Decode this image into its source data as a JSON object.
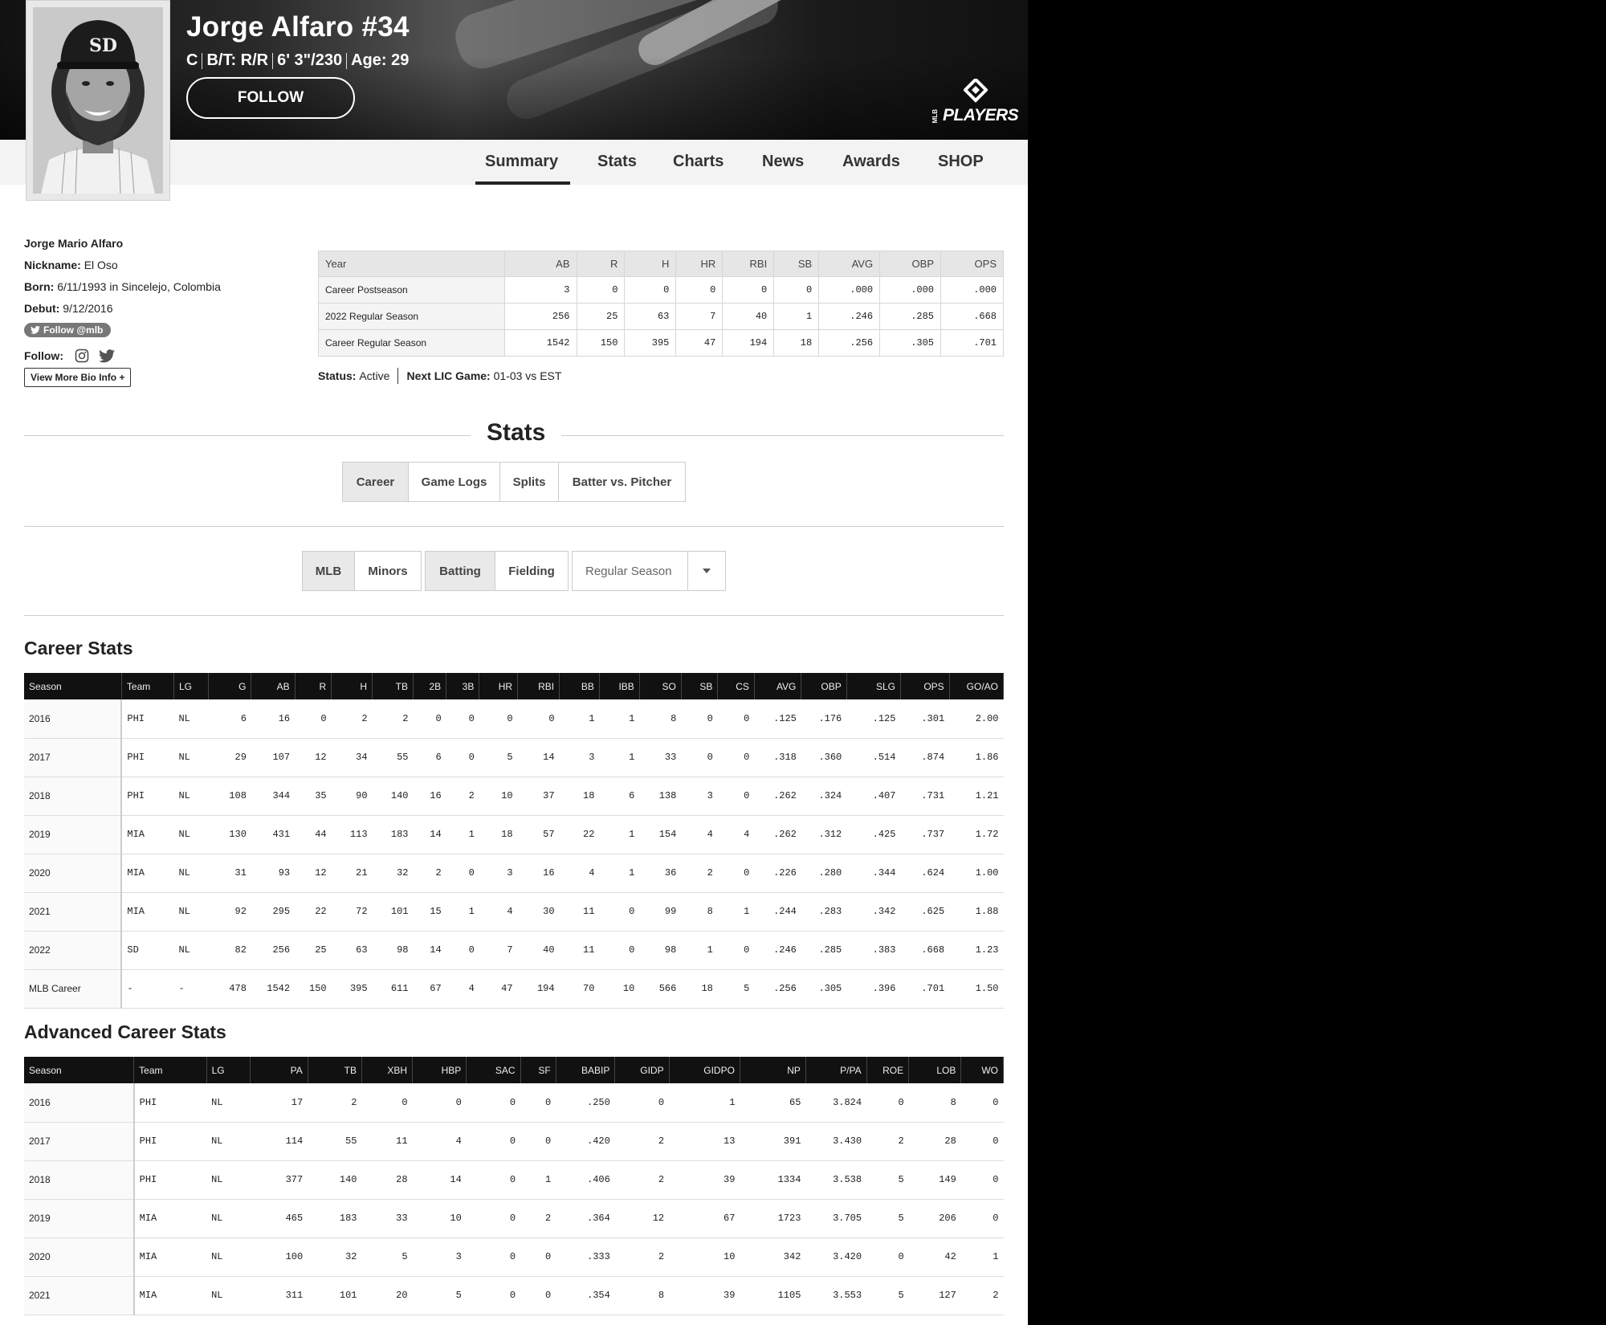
{
  "player": {
    "name": "Jorge Alfaro #34",
    "position": "C",
    "bt": "B/T: R/R",
    "height_weight": "6' 3\"/230",
    "age": "Age: 29",
    "follow_label": "FOLLOW"
  },
  "logo": {
    "word": "PLAYERS",
    "mlb": "MLB"
  },
  "nav": {
    "items": [
      "Summary",
      "Stats",
      "Charts",
      "News",
      "Awards",
      "SHOP"
    ],
    "active": "Summary"
  },
  "bio": {
    "full_name": "Jorge Mario Alfaro",
    "nickname_label": "Nickname:",
    "nickname": "El Oso",
    "born_label": "Born:",
    "born": "6/11/1993 in Sincelejo, Colombia",
    "debut_label": "Debut:",
    "debut": "9/12/2016",
    "twitter_button": "Follow @mlb",
    "follow_label": "Follow:",
    "more_label": "View More Bio Info +"
  },
  "summary": {
    "headers": [
      "Year",
      "AB",
      "R",
      "H",
      "HR",
      "RBI",
      "SB",
      "AVG",
      "OBP",
      "OPS"
    ],
    "rows": [
      [
        "Career Postseason",
        "3",
        "0",
        "0",
        "0",
        "0",
        "0",
        ".000",
        ".000",
        ".000"
      ],
      [
        "2022 Regular Season",
        "256",
        "25",
        "63",
        "7",
        "40",
        "1",
        ".246",
        ".285",
        ".668"
      ],
      [
        "Career Regular Season",
        "1542",
        "150",
        "395",
        "47",
        "194",
        "18",
        ".256",
        ".305",
        ".701"
      ]
    ],
    "status_label": "Status:",
    "status": "Active",
    "next_game_label": "Next LIC Game:",
    "next_game": "01-03 vs EST"
  },
  "stats_section": {
    "heading": "Stats",
    "tabs": [
      "Career",
      "Game Logs",
      "Splits",
      "Batter vs. Pitcher"
    ],
    "level_tabs": [
      "MLB",
      "Minors"
    ],
    "type_tabs": [
      "Batting",
      "Fielding"
    ],
    "season_select": "Regular Season"
  },
  "career": {
    "title": "Career Stats",
    "headers": [
      "Season",
      "Team",
      "LG",
      "G",
      "AB",
      "R",
      "H",
      "TB",
      "2B",
      "3B",
      "HR",
      "RBI",
      "BB",
      "IBB",
      "SO",
      "SB",
      "CS",
      "AVG",
      "OBP",
      "SLG",
      "OPS",
      "GO/AO"
    ],
    "rows": [
      [
        "2016",
        "PHI",
        "NL",
        "6",
        "16",
        "0",
        "2",
        "2",
        "0",
        "0",
        "0",
        "0",
        "1",
        "1",
        "8",
        "0",
        "0",
        ".125",
        ".176",
        ".125",
        ".301",
        "2.00"
      ],
      [
        "2017",
        "PHI",
        "NL",
        "29",
        "107",
        "12",
        "34",
        "55",
        "6",
        "0",
        "5",
        "14",
        "3",
        "1",
        "33",
        "0",
        "0",
        ".318",
        ".360",
        ".514",
        ".874",
        "1.86"
      ],
      [
        "2018",
        "PHI",
        "NL",
        "108",
        "344",
        "35",
        "90",
        "140",
        "16",
        "2",
        "10",
        "37",
        "18",
        "6",
        "138",
        "3",
        "0",
        ".262",
        ".324",
        ".407",
        ".731",
        "1.21"
      ],
      [
        "2019",
        "MIA",
        "NL",
        "130",
        "431",
        "44",
        "113",
        "183",
        "14",
        "1",
        "18",
        "57",
        "22",
        "1",
        "154",
        "4",
        "4",
        ".262",
        ".312",
        ".425",
        ".737",
        "1.72"
      ],
      [
        "2020",
        "MIA",
        "NL",
        "31",
        "93",
        "12",
        "21",
        "32",
        "2",
        "0",
        "3",
        "16",
        "4",
        "1",
        "36",
        "2",
        "0",
        ".226",
        ".280",
        ".344",
        ".624",
        "1.00"
      ],
      [
        "2021",
        "MIA",
        "NL",
        "92",
        "295",
        "22",
        "72",
        "101",
        "15",
        "1",
        "4",
        "30",
        "11",
        "0",
        "99",
        "8",
        "1",
        ".244",
        ".283",
        ".342",
        ".625",
        "1.88"
      ],
      [
        "2022",
        "SD",
        "NL",
        "82",
        "256",
        "25",
        "63",
        "98",
        "14",
        "0",
        "7",
        "40",
        "11",
        "0",
        "98",
        "1",
        "0",
        ".246",
        ".285",
        ".383",
        ".668",
        "1.23"
      ],
      [
        "MLB Career",
        "-",
        "-",
        "478",
        "1542",
        "150",
        "395",
        "611",
        "67",
        "4",
        "47",
        "194",
        "70",
        "10",
        "566",
        "18",
        "5",
        ".256",
        ".305",
        ".396",
        ".701",
        "1.50"
      ]
    ]
  },
  "advanced": {
    "title": "Advanced Career Stats",
    "headers": [
      "Season",
      "Team",
      "LG",
      "PA",
      "TB",
      "XBH",
      "HBP",
      "SAC",
      "SF",
      "BABIP",
      "GIDP",
      "GIDPO",
      "NP",
      "P/PA",
      "ROE",
      "LOB",
      "WO"
    ],
    "rows": [
      [
        "2016",
        "PHI",
        "NL",
        "17",
        "2",
        "0",
        "0",
        "0",
        "0",
        ".250",
        "0",
        "1",
        "65",
        "3.824",
        "0",
        "8",
        "0"
      ],
      [
        "2017",
        "PHI",
        "NL",
        "114",
        "55",
        "11",
        "4",
        "0",
        "0",
        ".420",
        "2",
        "13",
        "391",
        "3.430",
        "2",
        "28",
        "0"
      ],
      [
        "2018",
        "PHI",
        "NL",
        "377",
        "140",
        "28",
        "14",
        "0",
        "1",
        ".406",
        "2",
        "39",
        "1334",
        "3.538",
        "5",
        "149",
        "0"
      ],
      [
        "2019",
        "MIA",
        "NL",
        "465",
        "183",
        "33",
        "10",
        "0",
        "2",
        ".364",
        "12",
        "67",
        "1723",
        "3.705",
        "5",
        "206",
        "0"
      ],
      [
        "2020",
        "MIA",
        "NL",
        "100",
        "32",
        "5",
        "3",
        "0",
        "0",
        ".333",
        "2",
        "10",
        "342",
        "3.420",
        "0",
        "42",
        "1"
      ],
      [
        "2021",
        "MIA",
        "NL",
        "311",
        "101",
        "20",
        "5",
        "0",
        "0",
        ".354",
        "8",
        "39",
        "1105",
        "3.553",
        "5",
        "127",
        "2"
      ]
    ]
  }
}
